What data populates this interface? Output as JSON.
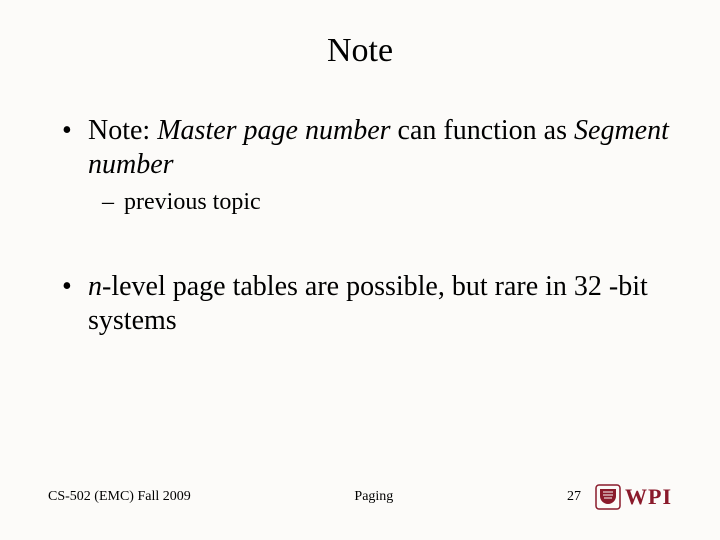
{
  "title": "Note",
  "bullet1": {
    "prefix": "Note: ",
    "italic1": "Master page number",
    "mid": " can function as ",
    "italic2": "Segment number",
    "sub": "previous topic"
  },
  "bullet2": {
    "italicLead": "n",
    "rest": "-level page tables are possible, but rare in 32 -bit systems"
  },
  "footer": {
    "left": "CS-502 (EMC) Fall 2009",
    "center": "Paging",
    "page": "27",
    "brand": "WPI"
  },
  "colors": {
    "brand": "#8a1a2b"
  }
}
